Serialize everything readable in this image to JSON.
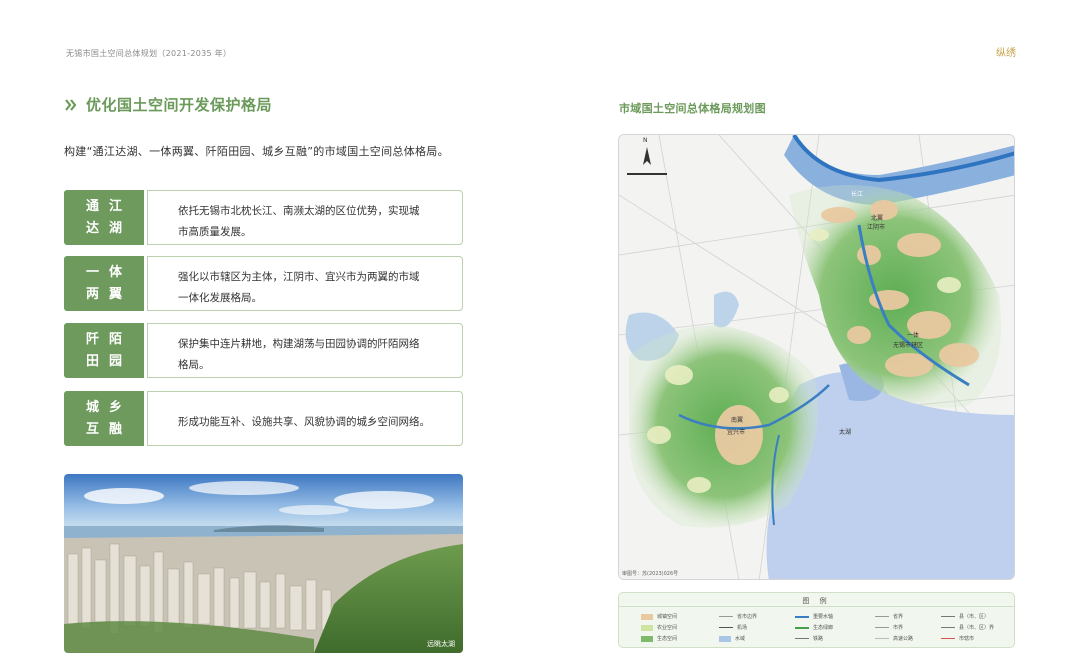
{
  "header": {
    "title": "无锡市国土空间总体规划（2021-2035 年）",
    "logo_text": "纵绣"
  },
  "section": {
    "title": "优化国土空间开发保护格局"
  },
  "intro": "构建“通江达湖、一体两翼、阡陌田园、城乡互融”的市域国土空间总体格局。",
  "cards": [
    {
      "tag1": "通江",
      "tag2": "达湖",
      "line1": "依托无锡市北枕长江、南濒太湖的区位优势，实现城",
      "line2": "市高质量发展。"
    },
    {
      "tag1": "一体",
      "tag2": "两翼",
      "line1": "强化以市辖区为主体，江阴市、宜兴市为两翼的市域",
      "line2": "一体化发展格局。"
    },
    {
      "tag1": "阡陌",
      "tag2": "田园",
      "line1": "保护集中连片耕地，构建湖荡与田园协调的阡陌网络",
      "line2": "格局。"
    },
    {
      "tag1": "城乡",
      "tag2": "互融",
      "line1": "形成功能互补、设施共享、风貌协调的城乡空间网络。",
      "line2": ""
    }
  ],
  "photo": {
    "caption": "远眺太湖"
  },
  "map": {
    "title": "市域国土空间总体格局规划图",
    "labels": {
      "river": "长江",
      "north_wing": "北翼",
      "north_city": "江阴市",
      "center_a": "一体",
      "center_b": "无锡市辖区",
      "south_wing": "南翼",
      "south_city": "宜兴市",
      "lake": "太湖",
      "north": "N"
    },
    "note": "审图号：苏(2023)026号"
  },
  "legend": {
    "title": "图 例",
    "items": [
      {
        "label": "城镇空间",
        "color": "#e8c9a0",
        "kind": "swatch"
      },
      {
        "label": "农业空间",
        "color": "#cfe3a2",
        "kind": "swatch"
      },
      {
        "label": "生态空间",
        "color": "#7dbb6a",
        "kind": "swatch"
      },
      {
        "label": "省市边界",
        "color": "#999999",
        "kind": "line"
      },
      {
        "label": "机场",
        "color": "#555555",
        "kind": "line"
      },
      {
        "label": "水域",
        "color": "#a9c6e6",
        "kind": "swatch"
      },
      {
        "label": "重要水轴",
        "color": "#3a7fc1",
        "kind": "line"
      },
      {
        "label": "生态绿廊",
        "color": "#4aa04a",
        "kind": "line"
      },
      {
        "label": "铁路",
        "color": "#777777",
        "kind": "line"
      },
      {
        "label": "省界",
        "color": "#999999",
        "kind": "line"
      },
      {
        "label": "市界",
        "color": "#999999",
        "kind": "line"
      },
      {
        "label": "高速公路",
        "color": "#bbbbbb",
        "kind": "line"
      },
      {
        "label": "县（市、区）",
        "color": "#777777",
        "kind": "line"
      },
      {
        "label": "县（市、区）界",
        "color": "#777777",
        "kind": "line"
      },
      {
        "label": "市辖市",
        "color": "#d9534f",
        "kind": "line"
      }
    ]
  },
  "colors": {
    "accent_green": "#6f9a5e",
    "card_border": "#b9d1ae",
    "title_green": "#6b9a5a"
  }
}
